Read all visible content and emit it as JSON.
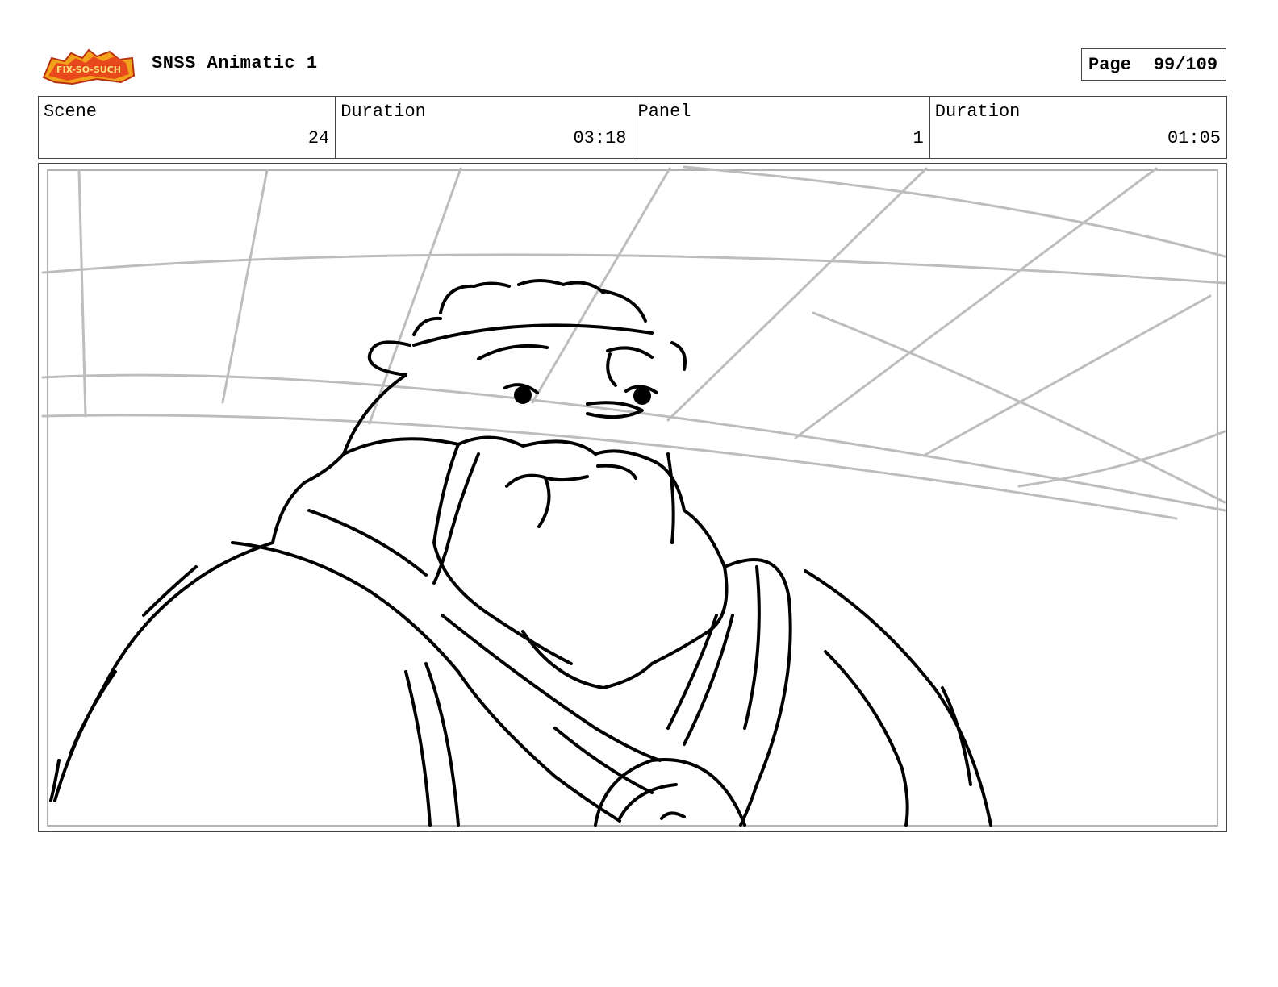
{
  "header": {
    "logo_text": "Sir Fix-So-Such",
    "title": "SNSS Animatic 1",
    "page_label": "Page",
    "page_value": "99/109"
  },
  "info": [
    {
      "label": "Scene",
      "value": "24"
    },
    {
      "label": "Duration",
      "value": "03:18"
    },
    {
      "label": "Panel",
      "value": "1"
    },
    {
      "label": "Duration",
      "value": "01:05"
    }
  ],
  "panel": {
    "content": "storyboard-sketch"
  }
}
